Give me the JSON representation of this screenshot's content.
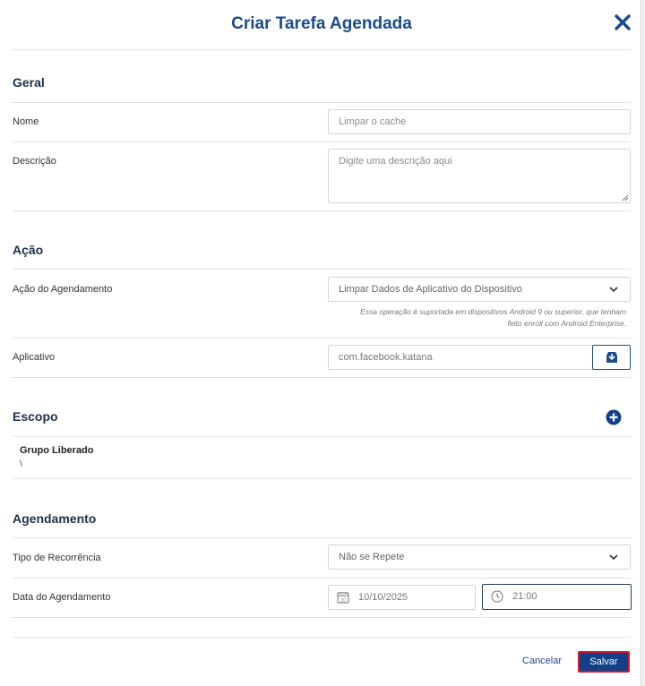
{
  "modal": {
    "title": "Criar Tarefa Agendada"
  },
  "sections": {
    "geral": "Geral",
    "acao": "Ação",
    "escopo": "Escopo",
    "agendamento": "Agendamento"
  },
  "geral": {
    "name_label": "Nome",
    "name_placeholder": "Limpar o cache",
    "description_label": "Descrição",
    "description_placeholder": "Digite uma descrição aqui"
  },
  "acao": {
    "action_label": "Ação do Agendamento",
    "action_value": "Limpar Dados de Aplicativo do Dispositivo",
    "action_hint_line1": "Essa operação é suportada em dispositivos Android 9 ou superior, que tenham",
    "action_hint_line2": "feito enroll com Android Enterprise.",
    "app_label": "Aplicativo",
    "app_value": "com.facebook.katana"
  },
  "escopo": {
    "group_name": "Grupo Liberado",
    "group_path": "\\"
  },
  "agendamento": {
    "recurrence_label": "Tipo de Recorrência",
    "recurrence_value": "Não se Repete",
    "date_label": "Data do Agendamento",
    "date_value": "10/10/2025",
    "calendar_day": "10",
    "time_value": "21:00"
  },
  "footer": {
    "cancel_label": "Cancelar",
    "save_label": "Salvar"
  },
  "colors": {
    "primary": "#1a4b8c",
    "save_bg": "#123f86",
    "save_outline": "#d0192b"
  },
  "icons": {
    "close": "close-icon",
    "chevron": "chevron-down-icon",
    "app_picker": "app-store-icon",
    "add": "plus-circle-icon",
    "calendar": "calendar-icon",
    "clock": "clock-icon"
  }
}
